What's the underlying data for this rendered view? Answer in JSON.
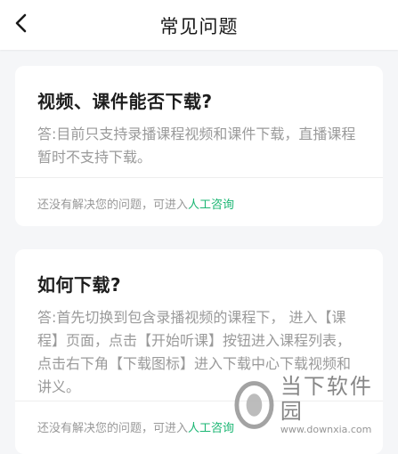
{
  "header": {
    "title": "常见问题",
    "back_icon": "chevron-left-icon"
  },
  "faq": [
    {
      "question": "视频、课件能否下载?",
      "answer": "答:目前只支持录播课程视频和课件下载，直播课程暂时不支持下载。",
      "footer_text": "还没有解决您的问题，可进入",
      "footer_link": "人工咨询"
    },
    {
      "question": "如何下载?",
      "answer": "答:首先切换到包含录播视频的课程下， 进入【课程】页面，点击【开始听课】按钮进入课程列表，点击右下角【下载图标】进入下载中心下载视频和讲义。",
      "footer_text": "还没有解决您的问题，可进入",
      "footer_link": "人工咨询"
    }
  ],
  "watermark": {
    "name": "当下软件园",
    "url": "www.downxia.com"
  },
  "colors": {
    "link": "#1bb673",
    "background": "#f5f6f8"
  }
}
